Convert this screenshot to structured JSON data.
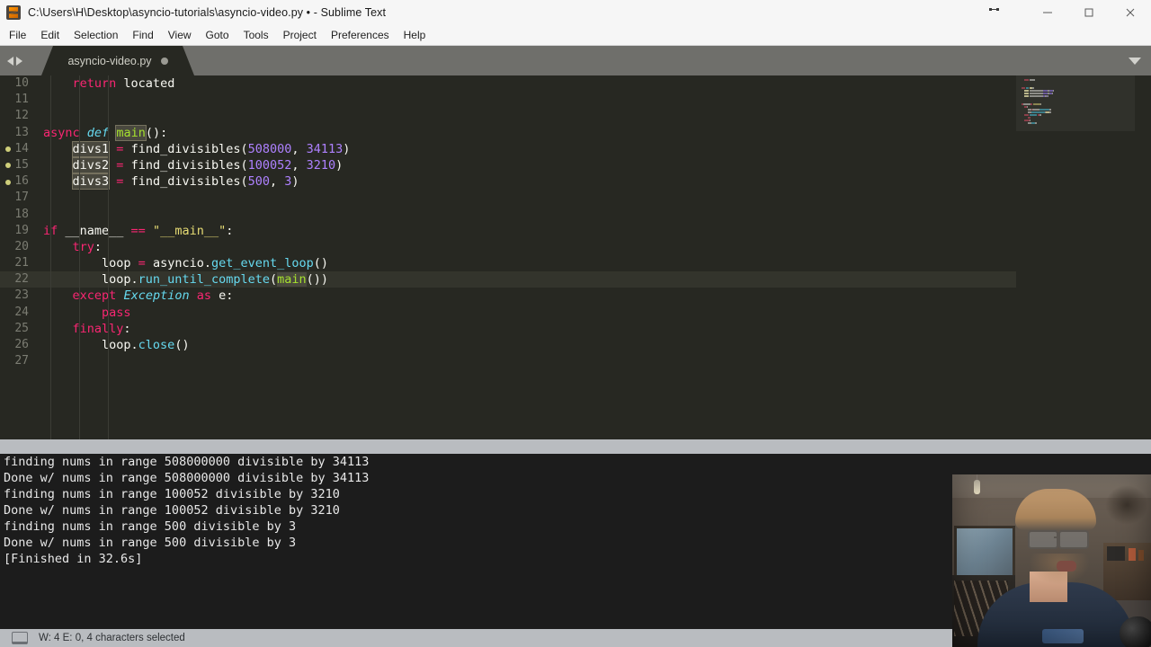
{
  "titlebar": {
    "title": "C:\\Users\\H\\Desktop\\asyncio-tutorials\\asyncio-video.py • - Sublime Text",
    "app_icon": "sublime-text-logo",
    "minimize_label": "—",
    "maximize_label": "□",
    "close_label": "✕"
  },
  "menubar": {
    "items": [
      {
        "label": "File"
      },
      {
        "label": "Edit"
      },
      {
        "label": "Selection"
      },
      {
        "label": "Find"
      },
      {
        "label": "View"
      },
      {
        "label": "Goto"
      },
      {
        "label": "Tools"
      },
      {
        "label": "Project"
      },
      {
        "label": "Preferences"
      },
      {
        "label": "Help"
      }
    ]
  },
  "tabbar": {
    "active_tab": "asyncio-video.py",
    "dirty_indicator": "unsaved-dot",
    "prev_icon": "triangle-left-icon",
    "next_icon": "triangle-right-icon",
    "menu_icon": "triangle-down-icon"
  },
  "editor": {
    "first_line_number": 10,
    "current_line": 22,
    "bookmarked_lines": [
      14,
      15,
      16
    ],
    "lines": [
      {
        "n": 10,
        "tokens": [
          {
            "t": "    ",
            "c": "plain"
          },
          {
            "t": "return",
            "c": "key"
          },
          {
            "t": " located",
            "c": "plain"
          }
        ]
      },
      {
        "n": 11,
        "tokens": []
      },
      {
        "n": 12,
        "tokens": []
      },
      {
        "n": 13,
        "tokens": [
          {
            "t": "async",
            "c": "key"
          },
          {
            "t": " ",
            "c": "plain"
          },
          {
            "t": "def",
            "c": "def"
          },
          {
            "t": " ",
            "c": "plain"
          },
          {
            "t": "main",
            "c": "fn",
            "sel": "box"
          },
          {
            "t": "():",
            "c": "plain"
          }
        ]
      },
      {
        "n": 14,
        "tokens": [
          {
            "t": "    ",
            "c": "plain"
          },
          {
            "t": "divs1",
            "c": "plain",
            "sel": "box"
          },
          {
            "t": " ",
            "c": "plain"
          },
          {
            "t": "=",
            "c": "op"
          },
          {
            "t": " find_divisibles(",
            "c": "plain"
          },
          {
            "t": "508000",
            "c": "num"
          },
          {
            "t": ", ",
            "c": "plain"
          },
          {
            "t": "34113",
            "c": "num"
          },
          {
            "t": ")",
            "c": "plain"
          }
        ]
      },
      {
        "n": 15,
        "tokens": [
          {
            "t": "    ",
            "c": "plain"
          },
          {
            "t": "divs2",
            "c": "plain",
            "sel": "box"
          },
          {
            "t": " ",
            "c": "plain"
          },
          {
            "t": "=",
            "c": "op"
          },
          {
            "t": " find_divisibles(",
            "c": "plain"
          },
          {
            "t": "100052",
            "c": "num"
          },
          {
            "t": ", ",
            "c": "plain"
          },
          {
            "t": "3210",
            "c": "num"
          },
          {
            "t": ")",
            "c": "plain"
          }
        ]
      },
      {
        "n": 16,
        "tokens": [
          {
            "t": "    ",
            "c": "plain"
          },
          {
            "t": "divs3",
            "c": "plain",
            "sel": "box"
          },
          {
            "t": " ",
            "c": "plain"
          },
          {
            "t": "=",
            "c": "op"
          },
          {
            "t": " find_divisibles(",
            "c": "plain"
          },
          {
            "t": "500",
            "c": "num"
          },
          {
            "t": ", ",
            "c": "plain"
          },
          {
            "t": "3",
            "c": "num"
          },
          {
            "t": ")",
            "c": "plain"
          }
        ]
      },
      {
        "n": 17,
        "tokens": []
      },
      {
        "n": 18,
        "tokens": []
      },
      {
        "n": 19,
        "tokens": [
          {
            "t": "if",
            "c": "key"
          },
          {
            "t": " __name__ ",
            "c": "plain"
          },
          {
            "t": "==",
            "c": "op"
          },
          {
            "t": " ",
            "c": "plain"
          },
          {
            "t": "\"__main__\"",
            "c": "str"
          },
          {
            "t": ":",
            "c": "plain"
          }
        ]
      },
      {
        "n": 20,
        "tokens": [
          {
            "t": "    ",
            "c": "plain"
          },
          {
            "t": "try",
            "c": "key"
          },
          {
            "t": ":",
            "c": "plain"
          }
        ]
      },
      {
        "n": 21,
        "tokens": [
          {
            "t": "        ",
            "c": "plain"
          },
          {
            "t": "loop ",
            "c": "plain"
          },
          {
            "t": "=",
            "c": "op"
          },
          {
            "t": " asyncio.",
            "c": "plain"
          },
          {
            "t": "get_event_loop",
            "c": "meth"
          },
          {
            "t": "()",
            "c": "plain"
          }
        ]
      },
      {
        "n": 22,
        "tokens": [
          {
            "t": "        ",
            "c": "plain"
          },
          {
            "t": "loop.",
            "c": "plain"
          },
          {
            "t": "run_until_complete",
            "c": "meth"
          },
          {
            "t": "(",
            "c": "plain"
          },
          {
            "t": "main",
            "c": "fn",
            "sel": "gray"
          },
          {
            "t": "())",
            "c": "plain"
          }
        ]
      },
      {
        "n": 23,
        "tokens": [
          {
            "t": "    ",
            "c": "plain"
          },
          {
            "t": "except",
            "c": "key"
          },
          {
            "t": " ",
            "c": "plain"
          },
          {
            "t": "Exception",
            "c": "def"
          },
          {
            "t": " ",
            "c": "plain"
          },
          {
            "t": "as",
            "c": "key"
          },
          {
            "t": " e:",
            "c": "plain"
          }
        ]
      },
      {
        "n": 24,
        "tokens": [
          {
            "t": "        ",
            "c": "plain"
          },
          {
            "t": "pass",
            "c": "key"
          }
        ]
      },
      {
        "n": 25,
        "tokens": [
          {
            "t": "    ",
            "c": "plain"
          },
          {
            "t": "finally",
            "c": "key"
          },
          {
            "t": ":",
            "c": "plain"
          }
        ]
      },
      {
        "n": 26,
        "tokens": [
          {
            "t": "        ",
            "c": "plain"
          },
          {
            "t": "loop.",
            "c": "plain"
          },
          {
            "t": "close",
            "c": "meth"
          },
          {
            "t": "()",
            "c": "plain"
          }
        ]
      },
      {
        "n": 27,
        "tokens": []
      }
    ]
  },
  "console": {
    "lines": [
      "finding nums in range 508000000 divisible by 34113",
      "Done w/ nums in range 508000000 divisible by 34113",
      "finding nums in range 100052 divisible by 3210",
      "Done w/ nums in range 100052 divisible by 3210",
      "finding nums in range 500 divisible by 3",
      "Done w/ nums in range 500 divisible by 3",
      "[Finished in 32.6s]"
    ]
  },
  "statusbar": {
    "icon": "monitor-icon",
    "text": "W: 4 E: 0, 4 characters selected"
  },
  "webcam": {
    "description": "webcam-overlay"
  },
  "colors": {
    "editor_bg": "#272822",
    "keyword": "#f92672",
    "type": "#66d9ef",
    "function": "#a6e22e",
    "number": "#ae81ff",
    "string": "#e6db74",
    "plain": "#f8f8f2",
    "console_bg": "#1c1c1c",
    "chrome": "#b9bcc0",
    "tabbar": "#6f6f6b"
  }
}
